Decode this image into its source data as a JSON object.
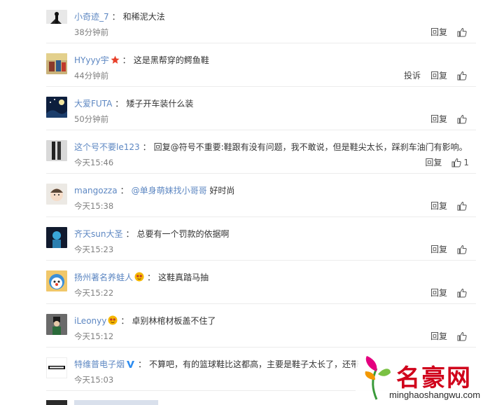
{
  "comments": [
    {
      "user": "小奇迹_7",
      "sep": "：",
      "text": "和稀泥大法",
      "time": "38分钟前",
      "actions": [
        "回复"
      ],
      "like_count": ""
    },
    {
      "user": "HYyyy宇",
      "sep": "：",
      "text": "这是黑帮穿的鳄鱼鞋",
      "time": "44分钟前",
      "actions": [
        "投诉",
        "回复"
      ],
      "like_count": "",
      "badge": "star-badge-icon"
    },
    {
      "user": "大爱FUTA",
      "sep": "：",
      "text": "矮子开车装什么装",
      "time": "50分钟前",
      "actions": [
        "回复"
      ],
      "like_count": ""
    },
    {
      "user": "这个号不要le123",
      "sep": "：",
      "text": "回复@符号不重要:鞋跟有没有问题，我不敢说，但是鞋尖太长，踩刹车油门有影响。",
      "time": "今天15:46",
      "actions": [
        "回复"
      ],
      "like_count": "1"
    },
    {
      "user": "mangozza",
      "sep": "：",
      "mention": "@单身萌妹找小哥哥",
      "text": " 好时尚",
      "time": "今天15:38",
      "actions": [
        "回复"
      ],
      "like_count": ""
    },
    {
      "user": "齐天sun大圣",
      "sep": "：",
      "text": "总要有一个罚款的依据啊",
      "time": "今天15:23",
      "actions": [
        "回复"
      ],
      "like_count": ""
    },
    {
      "user": "扬州著名养蛙人",
      "sep": "：",
      "text": "这鞋真踏马抽",
      "time": "今天15:22",
      "actions": [
        "回复"
      ],
      "like_count": "",
      "badge": "emoji-badge-icon"
    },
    {
      "user": "iLeonyy",
      "sep": "：",
      "text": "卓别林棺材板盖不住了",
      "time": "今天15:12",
      "actions": [
        "回复"
      ],
      "like_count": "",
      "badge": "emoji-badge-icon"
    },
    {
      "user": "特维普电子烟",
      "sep": "：",
      "text": "不算吧，有的篮球鞋比这都高，主要是鞋子太长了，还带",
      "time": "今天15:03",
      "actions": [],
      "like_count": "",
      "badge": "verified-v-icon"
    }
  ],
  "watermark": {
    "title": "名豪网",
    "url": "minghaoshangwu.com"
  },
  "colors": {
    "username": "#5d87c2",
    "time": "#808080",
    "divider": "#ececec",
    "star": "#e8402a",
    "verified": "#2d8cf0",
    "watermark": "#d0021b"
  }
}
